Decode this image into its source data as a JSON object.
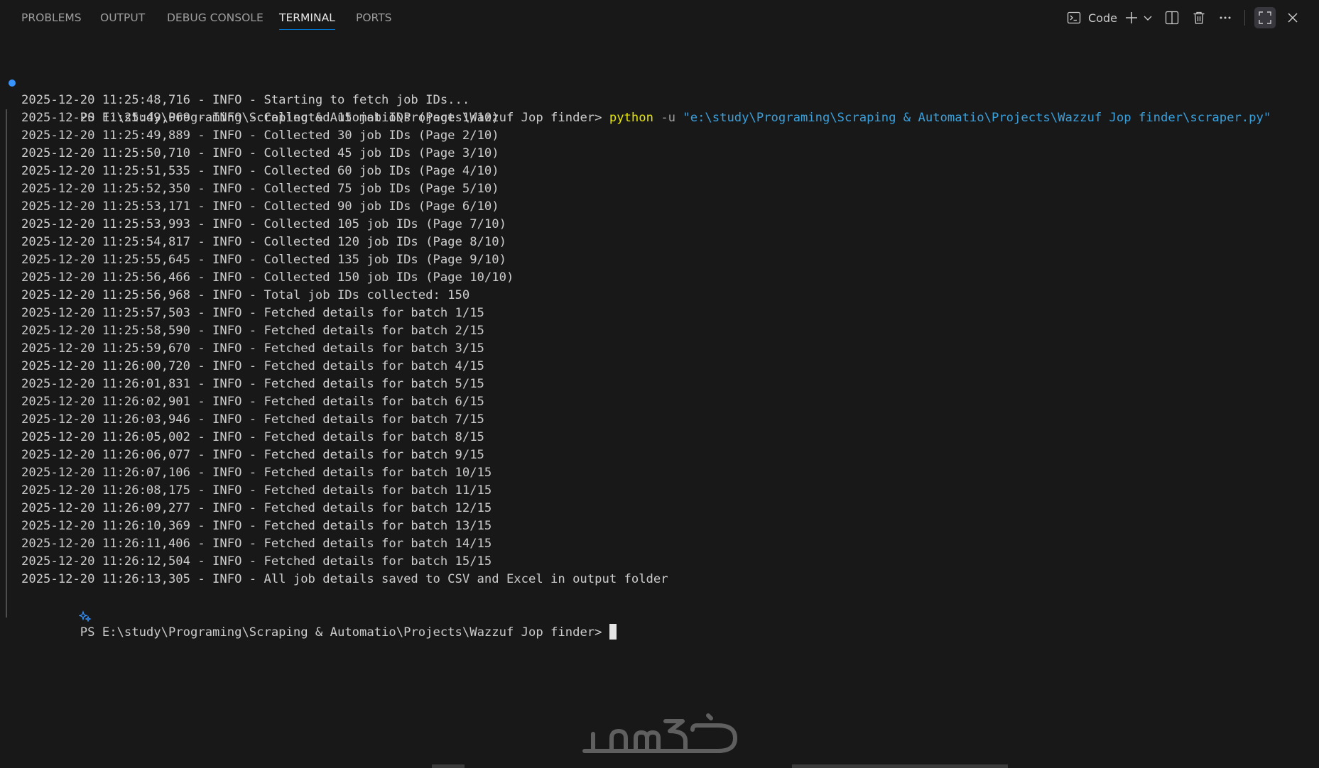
{
  "panel": {
    "tabs": [
      {
        "label": "PROBLEMS"
      },
      {
        "label": "OUTPUT"
      },
      {
        "label": "DEBUG CONSOLE"
      },
      {
        "label": "TERMINAL"
      },
      {
        "label": "PORTS"
      }
    ],
    "active_tab": "TERMINAL",
    "toolbar": {
      "profile_label": "Code",
      "icons": [
        "terminal-icon",
        "plus-icon",
        "chevron-down-icon",
        "split-icon",
        "trash-icon",
        "ellipsis-icon",
        "maximize-icon",
        "close-icon"
      ]
    }
  },
  "terminal": {
    "prompt": "PS E:\\study\\Programing\\Scraping & Automatio\\Projects\\Wazzuf Jop finder>",
    "command": "python",
    "command_flag": "-u",
    "command_path": "\"e:\\study\\Programing\\Scraping & Automatio\\Projects\\Wazzuf Jop finder\\scraper.py\"",
    "log_lines": [
      "2025-12-20 11:25:48,716 - INFO - Starting to fetch job IDs...",
      "2025-12-20 11:25:49,069 - INFO - Collected 15 job IDs (Page 1/10)",
      "2025-12-20 11:25:49,889 - INFO - Collected 30 job IDs (Page 2/10)",
      "2025-12-20 11:25:50,710 - INFO - Collected 45 job IDs (Page 3/10)",
      "2025-12-20 11:25:51,535 - INFO - Collected 60 job IDs (Page 4/10)",
      "2025-12-20 11:25:52,350 - INFO - Collected 75 job IDs (Page 5/10)",
      "2025-12-20 11:25:53,171 - INFO - Collected 90 job IDs (Page 6/10)",
      "2025-12-20 11:25:53,993 - INFO - Collected 105 job IDs (Page 7/10)",
      "2025-12-20 11:25:54,817 - INFO - Collected 120 job IDs (Page 8/10)",
      "2025-12-20 11:25:55,645 - INFO - Collected 135 job IDs (Page 9/10)",
      "2025-12-20 11:25:56,466 - INFO - Collected 150 job IDs (Page 10/10)",
      "2025-12-20 11:25:56,968 - INFO - Total job IDs collected: 150",
      "2025-12-20 11:25:57,503 - INFO - Fetched details for batch 1/15",
      "2025-12-20 11:25:58,590 - INFO - Fetched details for batch 2/15",
      "2025-12-20 11:25:59,670 - INFO - Fetched details for batch 3/15",
      "2025-12-20 11:26:00,720 - INFO - Fetched details for batch 4/15",
      "2025-12-20 11:26:01,831 - INFO - Fetched details for batch 5/15",
      "2025-12-20 11:26:02,901 - INFO - Fetched details for batch 6/15",
      "2025-12-20 11:26:03,946 - INFO - Fetched details for batch 7/15",
      "2025-12-20 11:26:05,002 - INFO - Fetched details for batch 8/15",
      "2025-12-20 11:26:06,077 - INFO - Fetched details for batch 9/15",
      "2025-12-20 11:26:07,106 - INFO - Fetched details for batch 10/15",
      "2025-12-20 11:26:08,175 - INFO - Fetched details for batch 11/15",
      "2025-12-20 11:26:09,277 - INFO - Fetched details for batch 12/15",
      "2025-12-20 11:26:10,369 - INFO - Fetched details for batch 13/15",
      "2025-12-20 11:26:11,406 - INFO - Fetched details for batch 14/15",
      "2025-12-20 11:26:12,504 - INFO - Fetched details for batch 15/15",
      "2025-12-20 11:26:13,305 - INFO - All job details saved to CSV and Excel in output folder"
    ],
    "final_prompt": "PS E:\\study\\Programing\\Scraping & Automatio\\Projects\\Wazzuf Jop finder>"
  },
  "watermark": {
    "text": "خمسات"
  },
  "colors": {
    "background": "#181818",
    "text": "#cccccc",
    "command": "#e5e510",
    "string": "#3aa0dc",
    "accent": "#0078d4",
    "decoration_dot": "#3794ff"
  }
}
